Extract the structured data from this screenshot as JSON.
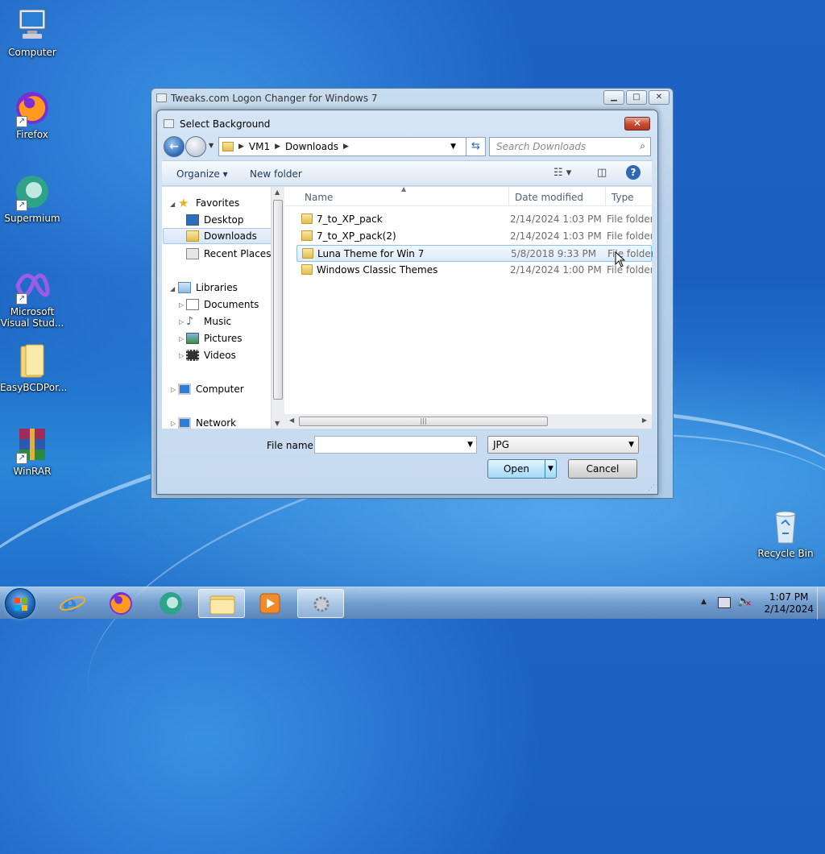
{
  "desktop": {
    "icons": [
      {
        "label": "Computer"
      },
      {
        "label": "Firefox"
      },
      {
        "label": "Supermium"
      },
      {
        "label": "Microsoft Visual Stud..."
      },
      {
        "label": "EasyBCDPor..."
      },
      {
        "label": "WinRAR"
      },
      {
        "label": "Recycle Bin"
      }
    ]
  },
  "main_window": {
    "title": "Tweaks.com Logon Changer for Windows 7",
    "minimize": "▁",
    "maximize": "□",
    "close": "✕"
  },
  "dialog": {
    "title": "Select Background",
    "close": "✕",
    "breadcrumb": [
      "VM1",
      "Downloads"
    ],
    "search_placeholder": "Search Downloads",
    "toolbar": {
      "organize": "Organize ▾",
      "new_folder": "New folder"
    },
    "nav": {
      "favorites": "Favorites",
      "desktop": "Desktop",
      "downloads": "Downloads",
      "recent": "Recent Places",
      "libraries": "Libraries",
      "documents": "Documents",
      "music": "Music",
      "pictures": "Pictures",
      "videos": "Videos",
      "computer": "Computer",
      "network": "Network"
    },
    "columns": {
      "name": "Name",
      "date": "Date modified",
      "type": "Type"
    },
    "files": [
      {
        "name": "7_to_XP_pack",
        "date": "2/14/2024 1:03 PM",
        "type": "File folder"
      },
      {
        "name": "7_to_XP_pack(2)",
        "date": "2/14/2024 1:03 PM",
        "type": "File folder"
      },
      {
        "name": "Luna Theme for Win 7",
        "date": "5/8/2018 9:33 PM",
        "type": "File folder"
      },
      {
        "name": "Windows Classic Themes",
        "date": "2/14/2024 1:00 PM",
        "type": "File folder"
      }
    ],
    "file_name_label": "File name:",
    "file_name_value": "",
    "file_type": "JPG",
    "open": "Open",
    "cancel": "Cancel"
  },
  "taskbar": {
    "time": "1:07 PM",
    "date": "2/14/2024"
  }
}
